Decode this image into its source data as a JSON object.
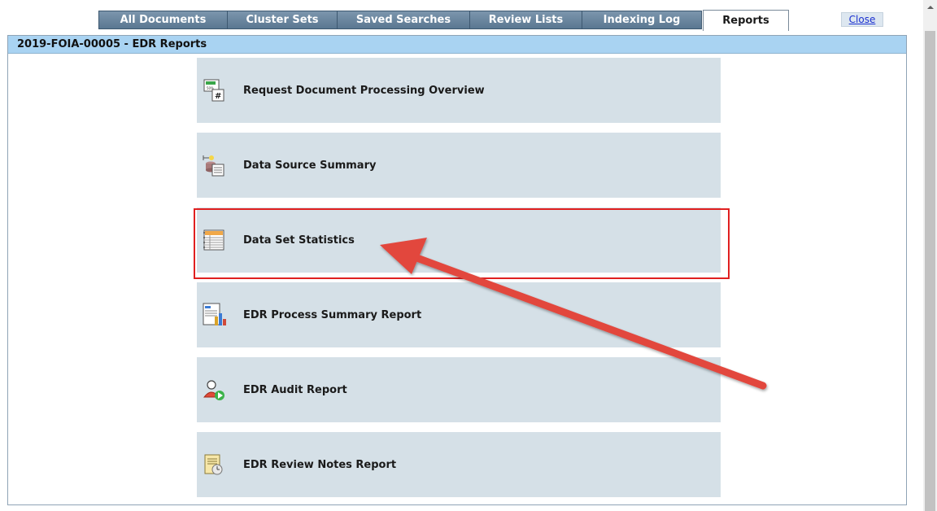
{
  "tabs": [
    {
      "label": "All Documents",
      "active": false
    },
    {
      "label": "Cluster Sets",
      "active": false
    },
    {
      "label": "Saved Searches",
      "active": false
    },
    {
      "label": "Review Lists",
      "active": false
    },
    {
      "label": "Indexing Log",
      "active": false
    },
    {
      "label": "Reports",
      "active": true
    }
  ],
  "close_label": "Close",
  "panel": {
    "title": "2019-FOIA-00005 - EDR Reports"
  },
  "reports": [
    {
      "label": "Request Document Processing Overview",
      "icon": "progress-chart-icon"
    },
    {
      "label": "Data Source Summary",
      "icon": "data-source-icon"
    },
    {
      "label": "Data Set Statistics",
      "icon": "spreadsheet-icon",
      "highlighted": true
    },
    {
      "label": "EDR Process Summary Report",
      "icon": "bar-chart-report-icon"
    },
    {
      "label": "EDR Audit Report",
      "icon": "user-audit-icon"
    },
    {
      "label": "EDR Review Notes Report",
      "icon": "review-notes-icon"
    }
  ],
  "annotation": {
    "highlight_color": "#e02020",
    "arrow_color": "#e2463e"
  }
}
